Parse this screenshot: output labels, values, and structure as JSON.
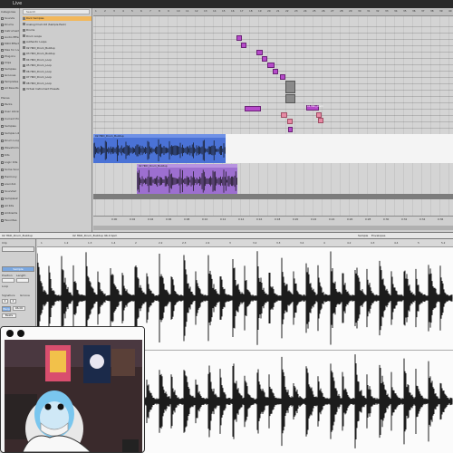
{
  "window": {
    "title": "Live"
  },
  "browser": {
    "search_placeholder": "Search",
    "sidebar_heading": "Categories",
    "categories": [
      "Sounds",
      "Drums",
      "Instruments",
      "Audio Effects",
      "MIDI Effects",
      "Max for Live",
      "Plug-Ins",
      "Clips",
      "Samples",
      "Grooves",
      "Templates",
      "All Results"
    ],
    "places_heading": "Places",
    "places": [
      "Packs",
      "User Library",
      "Current Project",
      "Samples",
      "Sample Library",
      "Drum Loops",
      "Waveformes",
      "Kits",
      "Logic Kits",
      "Some Sources",
      "Harmony",
      "sounds1",
      "Sounds2",
      "Samples2",
      "All Kits",
      "Ambients",
      "Favorites"
    ],
    "files": [
      {
        "name": "Rock Samples",
        "selected": true
      },
      {
        "name": "Analog Drum Kit (Sample Pack)",
        "selected": false
      },
      {
        "name": "Drums",
        "selected": false
      },
      {
        "name": "Drum Loops",
        "selected": false
      },
      {
        "name": "Authentic Loops",
        "selected": false
      },
      {
        "name": "02 HKD_Drum_Buildup",
        "selected": false
      },
      {
        "name": "03 HKD_Drum_Buildup",
        "selected": false
      },
      {
        "name": "04 HKD_Drum_Loop",
        "selected": false
      },
      {
        "name": "05 HKD_Drum_Loop",
        "selected": false
      },
      {
        "name": "06 HKD_Drum_Loop",
        "selected": false
      },
      {
        "name": "07 HKD_Drum_Loop",
        "selected": false
      },
      {
        "name": "08 HKD_Drum_Loop",
        "selected": false
      },
      {
        "name": "Virtual Instrument Presets",
        "selected": false
      }
    ]
  },
  "arrangement": {
    "ruler_ticks": [
      "1",
      "2",
      "3",
      "4",
      "5",
      "6",
      "7",
      "8",
      "9",
      "10",
      "11",
      "12",
      "13",
      "14",
      "15",
      "16",
      "17",
      "18",
      "19",
      "20",
      "21",
      "22",
      "23",
      "24",
      "25",
      "26",
      "27",
      "28",
      "29",
      "30",
      "31",
      "32",
      "33",
      "34",
      "35",
      "36",
      "37",
      "38",
      "39",
      "40"
    ],
    "bottom_ticks": [
      "0:00",
      "0:02",
      "0:04",
      "0:06",
      "0:08",
      "0:10",
      "0:12",
      "0:14",
      "0:16",
      "0:18",
      "0:20",
      "0:22",
      "0:24",
      "0:26",
      "0:28",
      "0:30",
      "0:32",
      "0:34",
      "0:36"
    ],
    "audio_clip_1": "02 HKD_Drum_Buildup",
    "audio_clip_2": "02 HKD_Drum_Buildup",
    "note_label": "02 HKD_Drum"
  },
  "status": {
    "left": "02 HKD_Drum_Buildup",
    "clip_name": "02 HKD_Drum_Buildup 96.0 bpm",
    "sample_label": "Sample",
    "envelope_label": "Envelopes"
  },
  "clip_props": {
    "clip_label": "Clip",
    "sample_label": "Sample",
    "position_label": "Position",
    "length_label": "Length",
    "loop_label": "Loop",
    "signature_label": "Signature",
    "groove_label": "Groove",
    "warp_label": "Warp",
    "sig_num": "4",
    "sig_den": "4",
    "bpm": "96.00",
    "mode": "Beats"
  },
  "sample_view": {
    "ruler_ticks": [
      "1",
      "1.2",
      "1.3",
      "1.4",
      "2",
      "2.2",
      "2.3",
      "2.4",
      "3",
      "3.2",
      "3.3",
      "3.4",
      "4",
      "4.2",
      "4.3",
      "4.4",
      "5",
      "5.2"
    ]
  },
  "colors": {
    "audio_clip": "#4a72d6",
    "audio_clip_2": "#9d6fd0",
    "midi_note": "#b54ac9",
    "selection": "#f2b75a"
  }
}
